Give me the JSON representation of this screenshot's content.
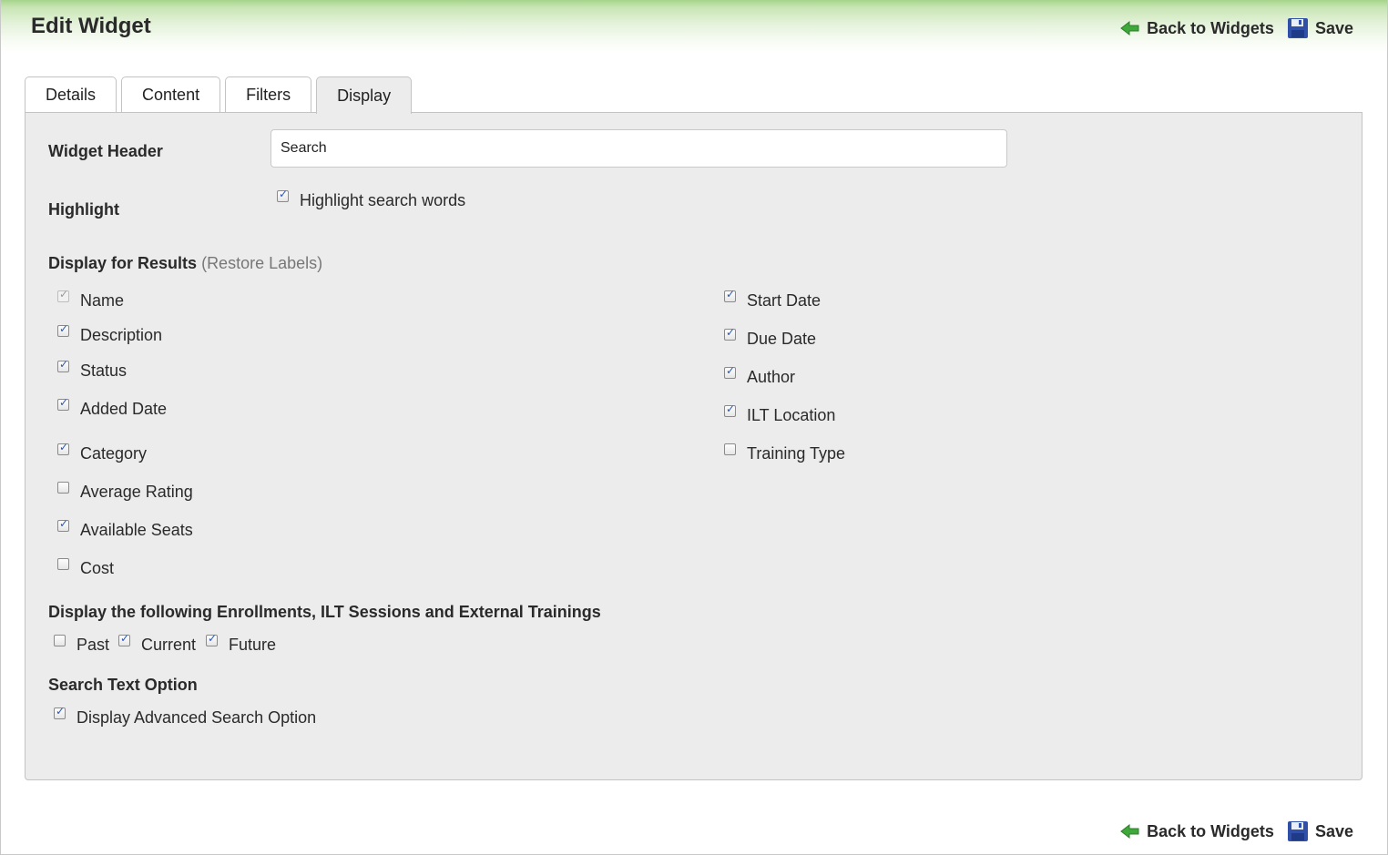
{
  "page": {
    "title": "Edit Widget"
  },
  "actions": {
    "back_label": "Back to Widgets",
    "save_label": "Save"
  },
  "tabs": [
    {
      "label": "Details",
      "active": false
    },
    {
      "label": "Content",
      "active": false
    },
    {
      "label": "Filters",
      "active": false
    },
    {
      "label": "Display",
      "active": true
    }
  ],
  "widget_header": {
    "label": "Widget Header",
    "value": "Search"
  },
  "highlight": {
    "label": "Highlight",
    "option_label": "Highlight search words",
    "checked": true
  },
  "display_results": {
    "heading": "Display for Results",
    "restore_link": "Restore Labels",
    "left": [
      {
        "label": "Name",
        "checked": true,
        "disabled": true
      },
      {
        "label": "Description",
        "checked": true
      },
      {
        "label": "Status",
        "checked": true
      },
      {
        "label": "Added Date",
        "checked": true
      },
      {
        "label": "Category",
        "checked": true
      },
      {
        "label": "Average Rating",
        "checked": false
      },
      {
        "label": "Available Seats",
        "checked": true
      },
      {
        "label": "Cost",
        "checked": false
      }
    ],
    "right": [
      {
        "label": "Start Date",
        "checked": true
      },
      {
        "label": "Due Date",
        "checked": true
      },
      {
        "label": "Author",
        "checked": true
      },
      {
        "label": "ILT Location",
        "checked": true
      },
      {
        "label": "Training Type",
        "checked": false
      }
    ]
  },
  "enrollments": {
    "heading": "Display the following Enrollments, ILT Sessions and External Trainings",
    "options": [
      {
        "label": "Past",
        "checked": false
      },
      {
        "label": "Current",
        "checked": true
      },
      {
        "label": "Future",
        "checked": true
      }
    ]
  },
  "search_text": {
    "heading": "Search Text Option",
    "option_label": "Display Advanced Search Option",
    "checked": true
  },
  "colors": {
    "header_green": "#a6d48a",
    "panel_bg": "#ececec",
    "check_blue": "#2b57b8",
    "save_icon_blue": "#2f4fa8",
    "back_arrow_green": "#3fa83a"
  }
}
